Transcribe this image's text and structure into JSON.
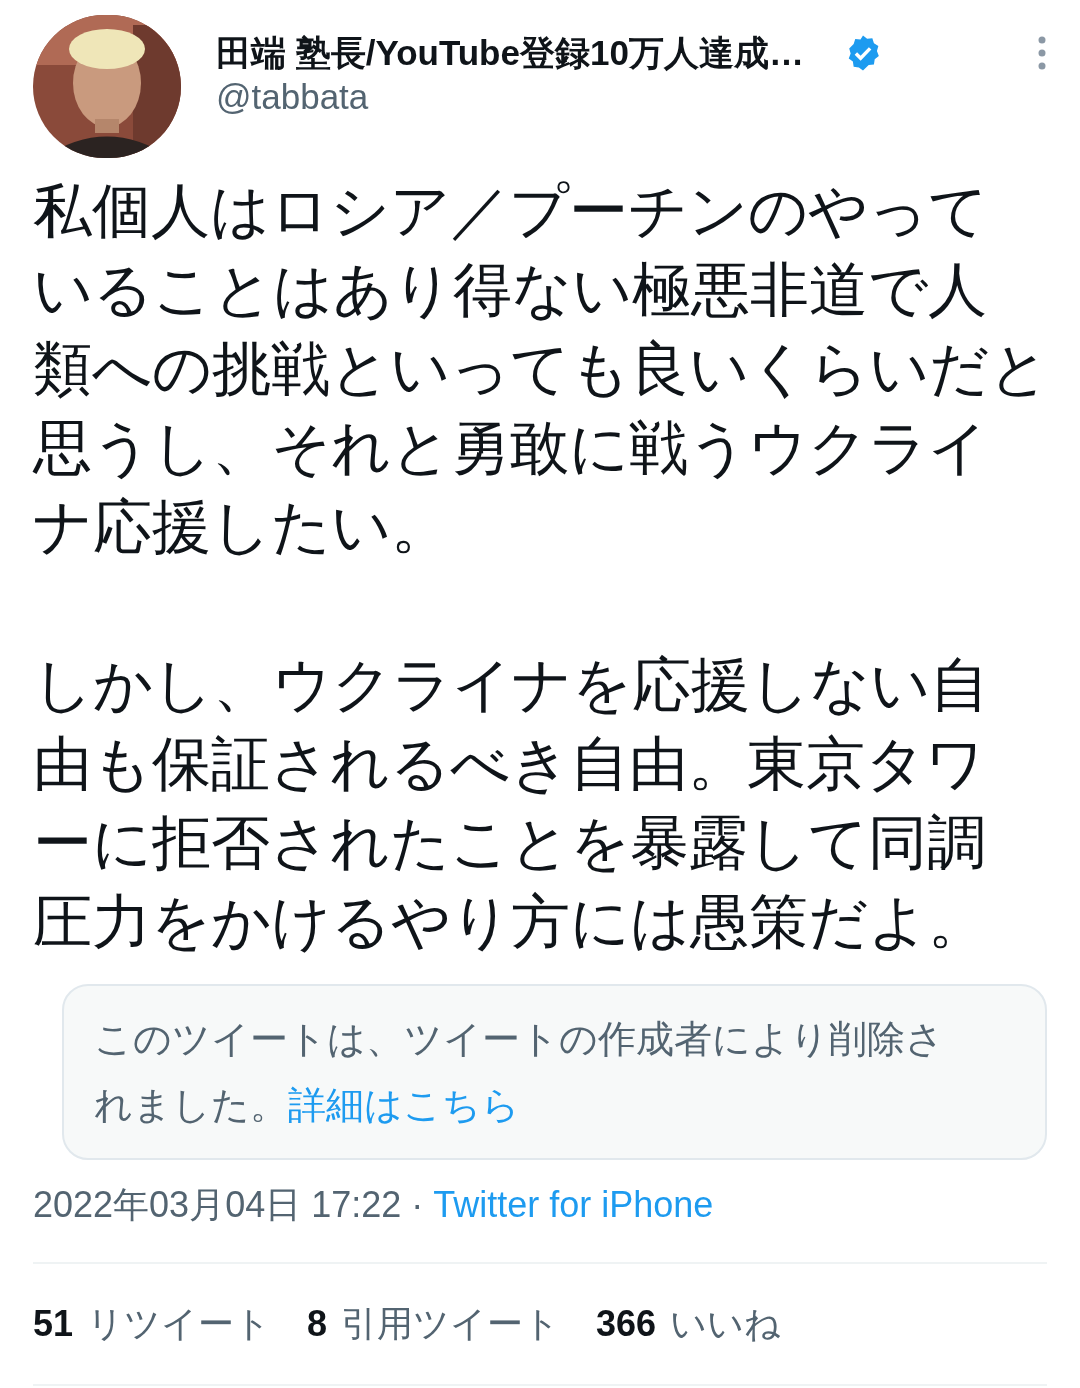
{
  "author": {
    "name": "田端 塾長/YouTube登録10万人達成…",
    "verified": true,
    "handle": "@tabbata"
  },
  "body": {
    "paragraphs": [
      [
        "私個人はロシア／プーチンのやって",
        "いることはあり得ない極悪非道で人",
        "類への挑戦といっても良いくらいだと",
        "思うし、それと勇敢に戦うウクライ",
        "ナ応援したい。"
      ],
      [
        "しかし、ウクライナを応援しない自",
        "由も保証されるべき自由。東京タワ",
        "ーに拒否されたことを暴露して同調",
        "圧力をかけるやり方には愚策だよ。"
      ]
    ]
  },
  "quoted": {
    "lines": [
      "このツイートは、ツイートの作成者により削除さ",
      "れました。"
    ],
    "link": "詳細はこちら"
  },
  "meta": {
    "timestamp": "2022年03月04日 17:22",
    "separator": "·",
    "source": "Twitter for iPhone"
  },
  "stats": [
    {
      "count": "51",
      "label": "リツイート"
    },
    {
      "count": "8",
      "label": "引用ツイート"
    },
    {
      "count": "366",
      "label": "いいね"
    }
  ]
}
